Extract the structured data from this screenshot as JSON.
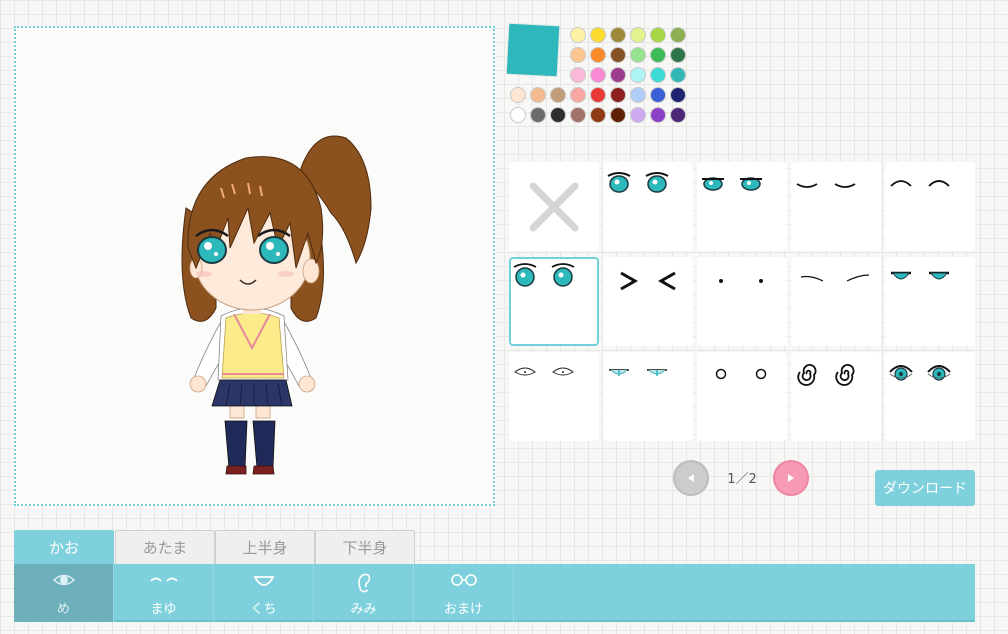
{
  "current_color": "#2eb8bc",
  "palette": [
    [
      "#fdf2a4",
      "#fddb2f",
      "#9d8738",
      "#e2f38e",
      "#a5d844",
      "#8dae51"
    ],
    [
      "#fcc691",
      "#fb8a2b",
      "#855024",
      "#96e28f",
      "#3cbc56",
      "#2e7449"
    ],
    [
      "#fbb9d9",
      "#fb8ad4",
      "#9b3c8c",
      "#aef4f7",
      "#3ddbd6",
      "#33b6b6"
    ],
    [
      "#fde6d3",
      "#f3b98f",
      "#c29b79",
      "#f9a7a2",
      "#ea3a37",
      "#8d1f1f",
      "#b1cdf8",
      "#3b5fd6",
      "#1e2470"
    ],
    [
      "#ffffff",
      "#6b6b6b",
      "#2e2e2e",
      "#a27167",
      "#8e3b15",
      "#5e2107",
      "#ceaaf0",
      "#8c40c6",
      "#4e2677"
    ]
  ],
  "grid": {
    "selected_index": 5,
    "items": [
      "none-x-icon",
      "eyes-sparkle-icon",
      "eyes-half-open-icon",
      "eyes-closed-smile-icon",
      "eyes-arched-closed-icon",
      "eyes-round-teal-icon",
      "eyes-squint-arrows-icon",
      "eyes-dots-icon",
      "eyes-thin-lines-icon",
      "eyes-sleepy-teal-icon",
      "eyes-white-outline-icon",
      "eyes-narrow-teal-icon",
      "eyes-small-circles-icon",
      "eyes-spiral-icon",
      "eyes-wide-teal-icon"
    ]
  },
  "pager": {
    "indicator": "1／2",
    "prev_icon": "triangle-left-icon",
    "next_icon": "triangle-right-icon"
  },
  "download_label": "ダウンロード",
  "tabs": [
    {
      "label": "かお",
      "active": true
    },
    {
      "label": "あたま",
      "active": false
    },
    {
      "label": "上半身",
      "active": false
    },
    {
      "label": "下半身",
      "active": false
    }
  ],
  "parts": [
    {
      "label": "め",
      "icon": "eye-icon",
      "active": true
    },
    {
      "label": "まゆ",
      "icon": "eyebrows-icon",
      "active": false
    },
    {
      "label": "くち",
      "icon": "mouth-icon",
      "active": false
    },
    {
      "label": "みみ",
      "icon": "ear-icon",
      "active": false
    },
    {
      "label": "おまけ",
      "icon": "glasses-icon",
      "active": false
    }
  ]
}
